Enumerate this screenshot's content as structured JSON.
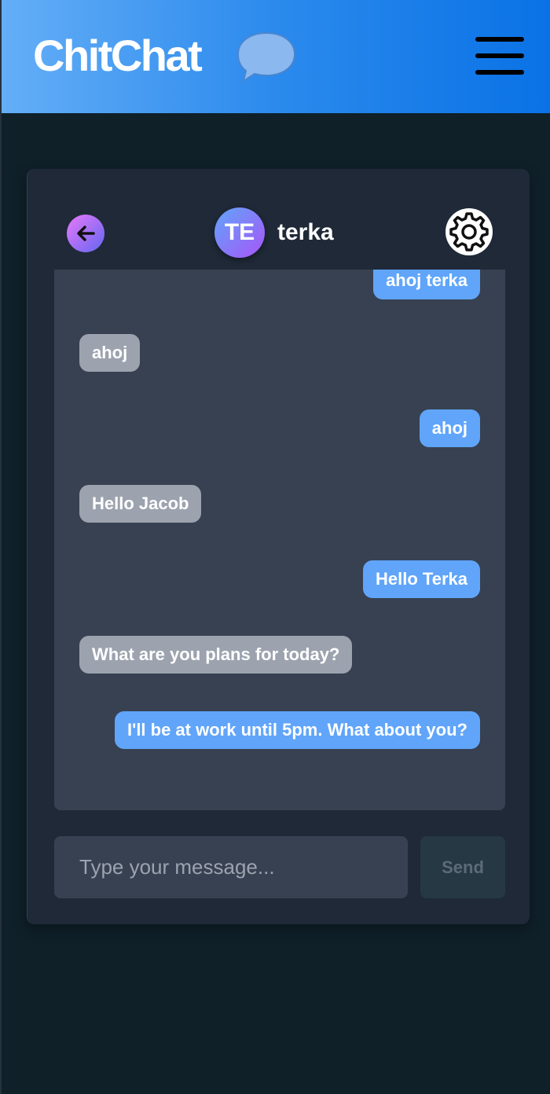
{
  "app": {
    "brand": "ChitChat",
    "brand_icon": "speech-bubble-icon",
    "menu_icon": "hamburger-menu-icon",
    "colors": {
      "header_start": "#64aef7",
      "header_end": "#0a72e6",
      "background": "#0f2029",
      "card": "#1f2937",
      "panel": "#374151",
      "sent_bubble": "#60a5fa",
      "received_bubble": "#9ca3af"
    }
  },
  "chat": {
    "contact_initials": "TE",
    "contact_name": "terka",
    "back_icon": "arrow-left-icon",
    "settings_icon": "gear-icon",
    "messages": [
      {
        "direction": "sent",
        "text": "ahoj terka"
      },
      {
        "direction": "received",
        "text": "ahoj"
      },
      {
        "direction": "sent",
        "text": "ahoj"
      },
      {
        "direction": "received",
        "text": "Hello Jacob"
      },
      {
        "direction": "sent",
        "text": "Hello Terka"
      },
      {
        "direction": "received",
        "text": "What are you plans for today?"
      },
      {
        "direction": "sent",
        "text": "I'll be at work until 5pm. What about you?"
      }
    ]
  },
  "composer": {
    "placeholder": "Type your message...",
    "value": "",
    "send_label": "Send"
  }
}
